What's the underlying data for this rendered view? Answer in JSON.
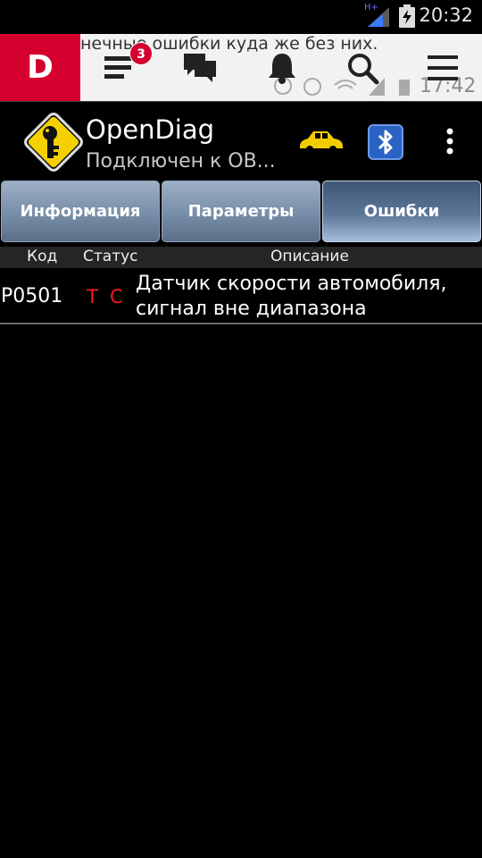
{
  "status_bar": {
    "time": "20:32",
    "network_label": "H+"
  },
  "top_nav": {
    "logo_letter": "D",
    "ghost_text": "нечные ошибки куда же без них.",
    "ghost_time": "17:42",
    "badge_count": "3",
    "icons": [
      "news-icon",
      "chat-icon",
      "bell-icon",
      "search-icon",
      "menu-icon"
    ]
  },
  "app": {
    "title": "OpenDiag",
    "subtitle": "Подключен к OB...",
    "colors": {
      "accent_yellow": "#f2cc00",
      "brand_red": "#d5002e",
      "bluetooth_blue": "#2a63c4"
    }
  },
  "tabs": [
    {
      "label": "Информация",
      "active": false
    },
    {
      "label": "Параметры",
      "active": false
    },
    {
      "label": "Ошибки",
      "active": true
    }
  ],
  "table": {
    "headers": {
      "code": "Код",
      "status": "Статус",
      "description": "Описание"
    },
    "rows": [
      {
        "code": "P0501",
        "status_t": "T",
        "status_c": "C",
        "description_line1": "Датчик скорости автомобиля,",
        "description_line2": "сигнал вне диапазона"
      }
    ]
  }
}
